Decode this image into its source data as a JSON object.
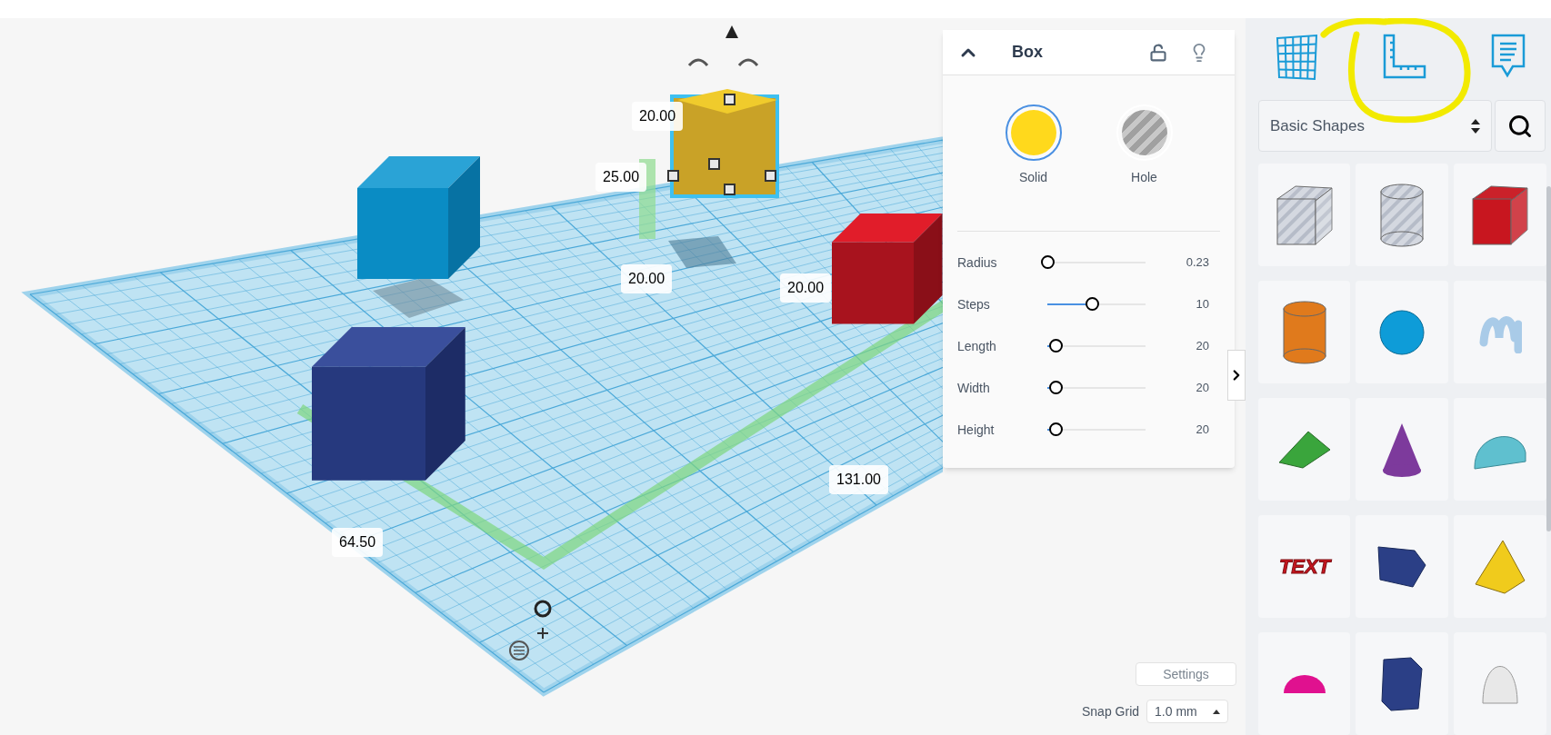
{
  "viewport": {
    "dimension_labels": [
      "20.00",
      "25.00",
      "20.00",
      "20.00",
      "131.00",
      "64.50"
    ]
  },
  "inspector": {
    "expanded": true,
    "title": "Box",
    "locked": false,
    "modes": [
      {
        "label": "Solid",
        "kind": "solid",
        "selected": true
      },
      {
        "label": "Hole",
        "kind": "hole",
        "selected": false
      }
    ],
    "sliders": [
      {
        "name": "Radius",
        "level": 0,
        "reading": "0.23"
      },
      {
        "name": "Steps",
        "level": 0.45,
        "reading": "10"
      },
      {
        "name": "Length",
        "level": 0.08,
        "reading": "20"
      },
      {
        "name": "Width",
        "level": 0.08,
        "reading": "20"
      },
      {
        "name": "Height",
        "level": 0.08,
        "reading": "20"
      }
    ]
  },
  "settings_button": "Settings",
  "snap_grid": {
    "label": "Snap Grid",
    "value": "1.0 mm"
  },
  "sidebar": {
    "category": "Basic Shapes",
    "shapes": [
      {
        "kind": "box",
        "color": "#c8ccd4",
        "hole": true
      },
      {
        "kind": "cylinder",
        "color": "#c8ccd4",
        "hole": true
      },
      {
        "kind": "box",
        "color": "#c8161f",
        "hole": false
      },
      {
        "kind": "cylinder",
        "color": "#e07a1c",
        "hole": false
      },
      {
        "kind": "sphere",
        "color": "#0e9cd8",
        "hole": false
      },
      {
        "kind": "scribble",
        "color": "#a9cbe8",
        "hole": false
      },
      {
        "kind": "roof",
        "color": "#3aa53c",
        "hole": false
      },
      {
        "kind": "cone",
        "color": "#7d3a9c",
        "hole": false
      },
      {
        "kind": "round-roof",
        "color": "#5fc0cf",
        "hole": false
      },
      {
        "kind": "text",
        "color": "#c8161f",
        "hole": false,
        "text": "TEXT"
      },
      {
        "kind": "wedge",
        "color": "#2b3f86",
        "hole": false
      },
      {
        "kind": "pyramid",
        "color": "#f0cb1c",
        "hole": false
      },
      {
        "kind": "half-sphere",
        "color": "#e0118f",
        "hole": false
      },
      {
        "kind": "polygon",
        "color": "#2b3f86",
        "hole": false
      },
      {
        "kind": "paraboloid",
        "color": "#e8e8e8",
        "hole": false
      }
    ]
  }
}
